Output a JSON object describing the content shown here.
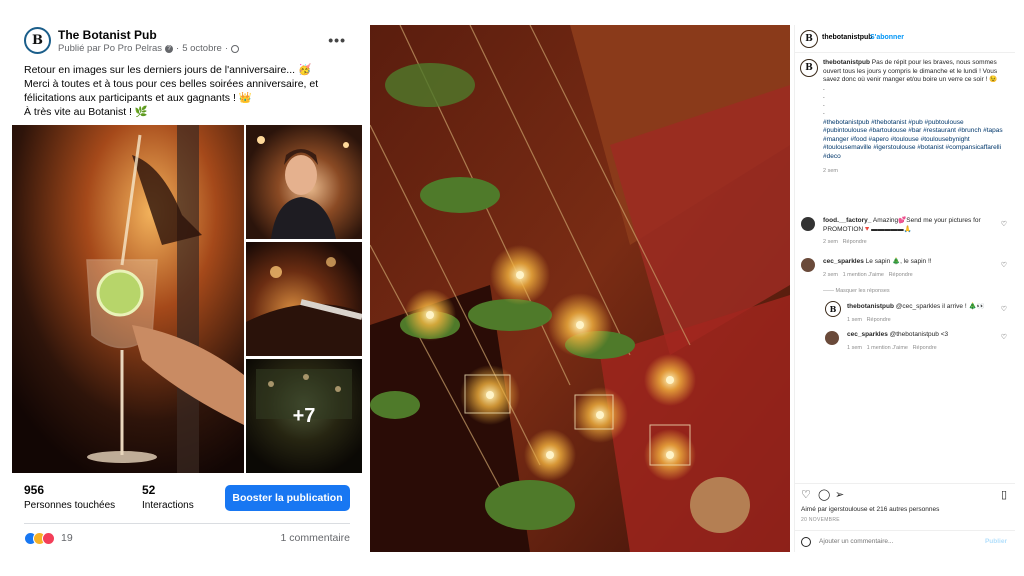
{
  "facebook": {
    "page_name": "The Botanist Pub",
    "avatar_letter": "B",
    "published_by": "Publié par Po Pro Pelras",
    "date": "5 octobre",
    "text_lines": [
      "Retour en images sur les derniers jours de l'anniversaire... 🥳",
      "Merci à toutes et à tous pour ces belles soirées anniversaire, et",
      "félicitations aux participants et aux gagnants ! 👑",
      "À très vite au Botanist ! 🌿"
    ],
    "more_photos": "+7",
    "reach_value": "956",
    "reach_label": "Personnes touchées",
    "interactions_value": "52",
    "interactions_label": "Interactions",
    "boost_button": "Booster la publication",
    "reactions_count": "19",
    "comments": "1 commentaire"
  },
  "instagram": {
    "username": "thebotanistpub",
    "follow": "S'abonner",
    "caption_user": "thebotanistpub",
    "caption_text": "Pas de répit pour les braves, nous sommes ouvert tous les jours y compris le dimanche et le lundi ! Vous savez donc où venir manger et/ou boire un verre ce soir ! 😉",
    "hashtags": "#thebotanistpub #thebotanist #pub #pubtoulouse #pubintoulouse #bartoulouse #bar #restaurant #brunch #tapas #manger #food #apero #toulouse #toulousebynight #toulousemaville #igerstoulouse #botanist #compansicaffarelli #deco",
    "caption_time": "2 sem",
    "comments": [
      {
        "user": "food.__factory_",
        "text": "Amazing💕Send me your pictures for PROMOTION🔻▬▬▬▬▬🙏",
        "meta": "2 sem",
        "reply": "Répondre"
      },
      {
        "user": "cec_sparkles",
        "text": "Le sapin 🎄, le sapin !!",
        "meta": "2 sem",
        "likes": "1 mention J'aime",
        "reply": "Répondre"
      }
    ],
    "hide_replies": "Masquer les réponses",
    "replies": [
      {
        "user": "thebotanistpub",
        "text": "@cec_sparkles il arrive ! 🎄👀",
        "meta": "1 sem",
        "reply": "Répondre"
      },
      {
        "user": "cec_sparkles",
        "text": "@thebotanistpub <3",
        "meta": "1 sem",
        "likes": "1 mention J'aime",
        "reply": "Répondre"
      }
    ],
    "liked_by": "Aimé par igerstoulouse et 216 autres personnes",
    "date": "20 NOVEMBRE",
    "add_comment_placeholder": "Ajouter un commentaire...",
    "post_label": "Publier"
  }
}
